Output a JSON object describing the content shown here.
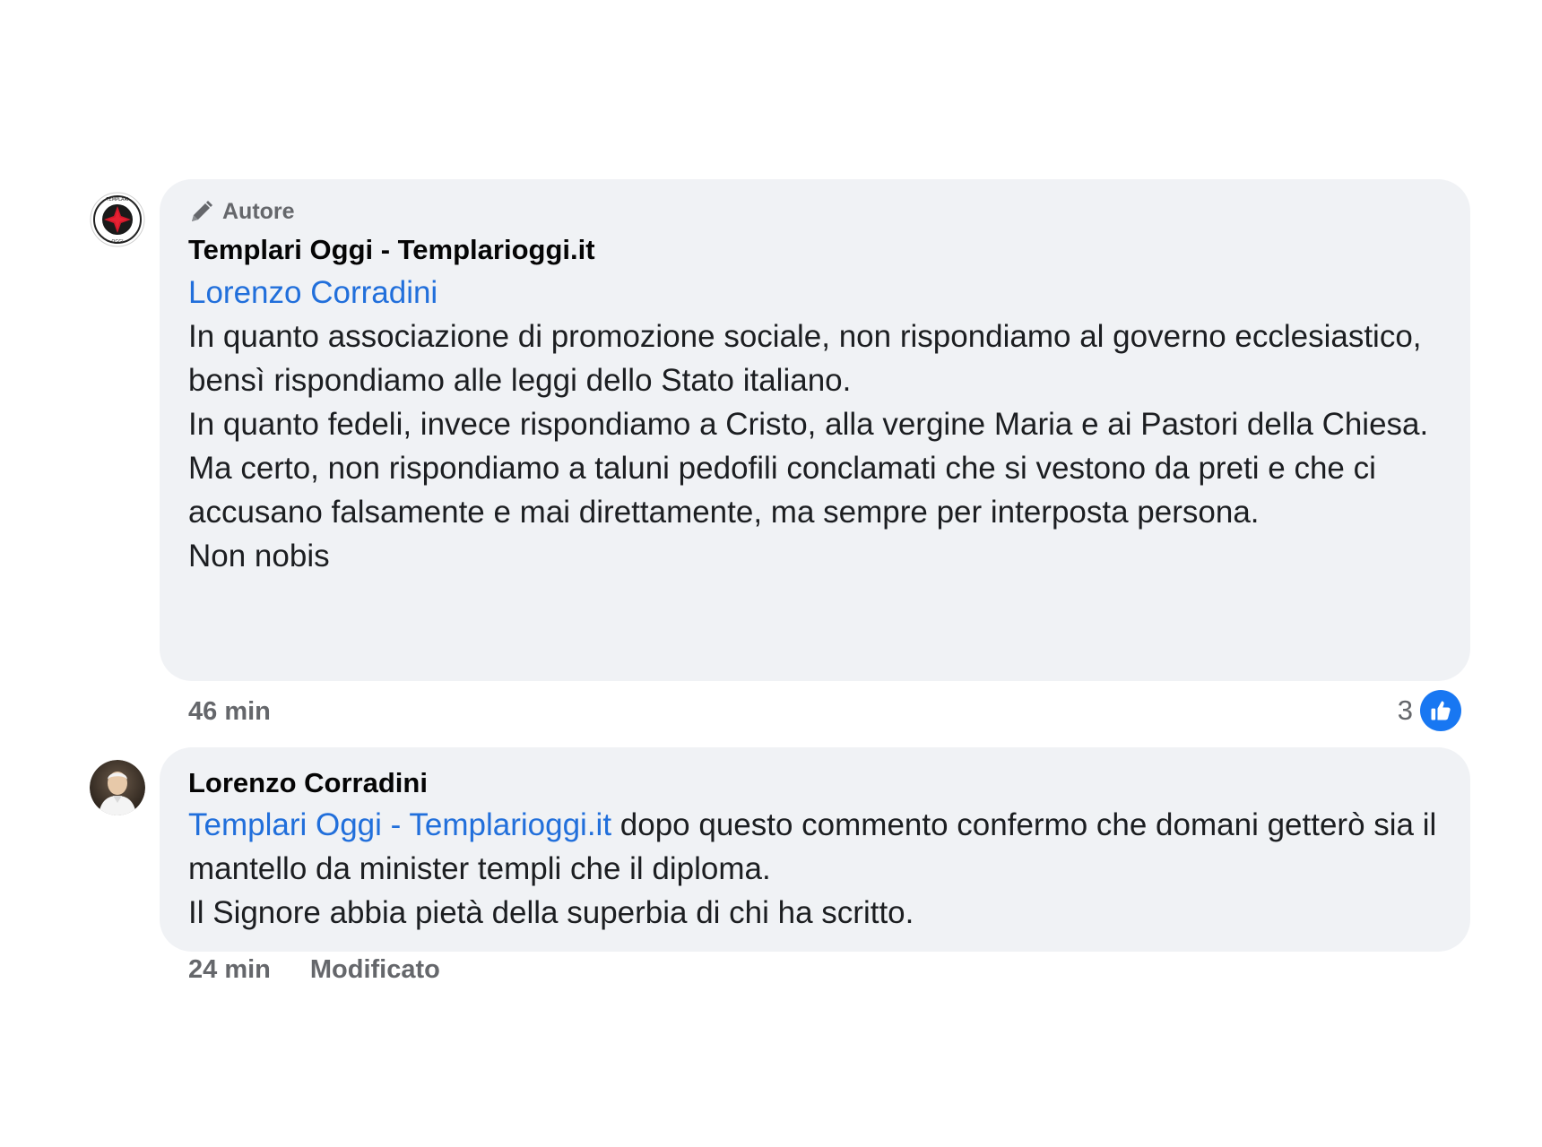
{
  "comments": [
    {
      "badge": "Autore",
      "author": "Templari Oggi - Templarioggi.it",
      "mention": "Lorenzo Corradini",
      "paragraphs": [
        "In quanto associazione di promozione sociale, non rispondiamo al governo ecclesiastico, bensì rispondiamo alle leggi dello Stato italiano.",
        "In quanto fedeli, invece rispondiamo a Cristo, alla vergine Maria e ai Pastori della Chiesa.",
        "Ma certo, non rispondiamo a taluni pedofili conclamati che si vestono da preti e che ci accusano falsamente e mai direttamente, ma sempre per interposta persona.",
        "Non nobis"
      ],
      "time": "46 min",
      "reaction_count": "3",
      "avatar_icon": "templari-oggi-logo-icon",
      "accent": "#1877f2"
    },
    {
      "author": "Lorenzo Corradini",
      "mention": "Templari Oggi - Templarioggi.it",
      "first_line_rest": " dopo questo commento confermo che domani getterò sia il mantello da minister templi che il diploma.",
      "paragraphs": [
        "Il Signore abbia pietà della superbia di chi ha scritto."
      ],
      "time": "24 min",
      "edited": "Modificato",
      "avatar_icon": "user-photo-icon"
    }
  ],
  "colors": {
    "bubble": "#f0f2f5",
    "mention": "#216fdb",
    "meta": "#65676b",
    "like": "#1877f2"
  }
}
